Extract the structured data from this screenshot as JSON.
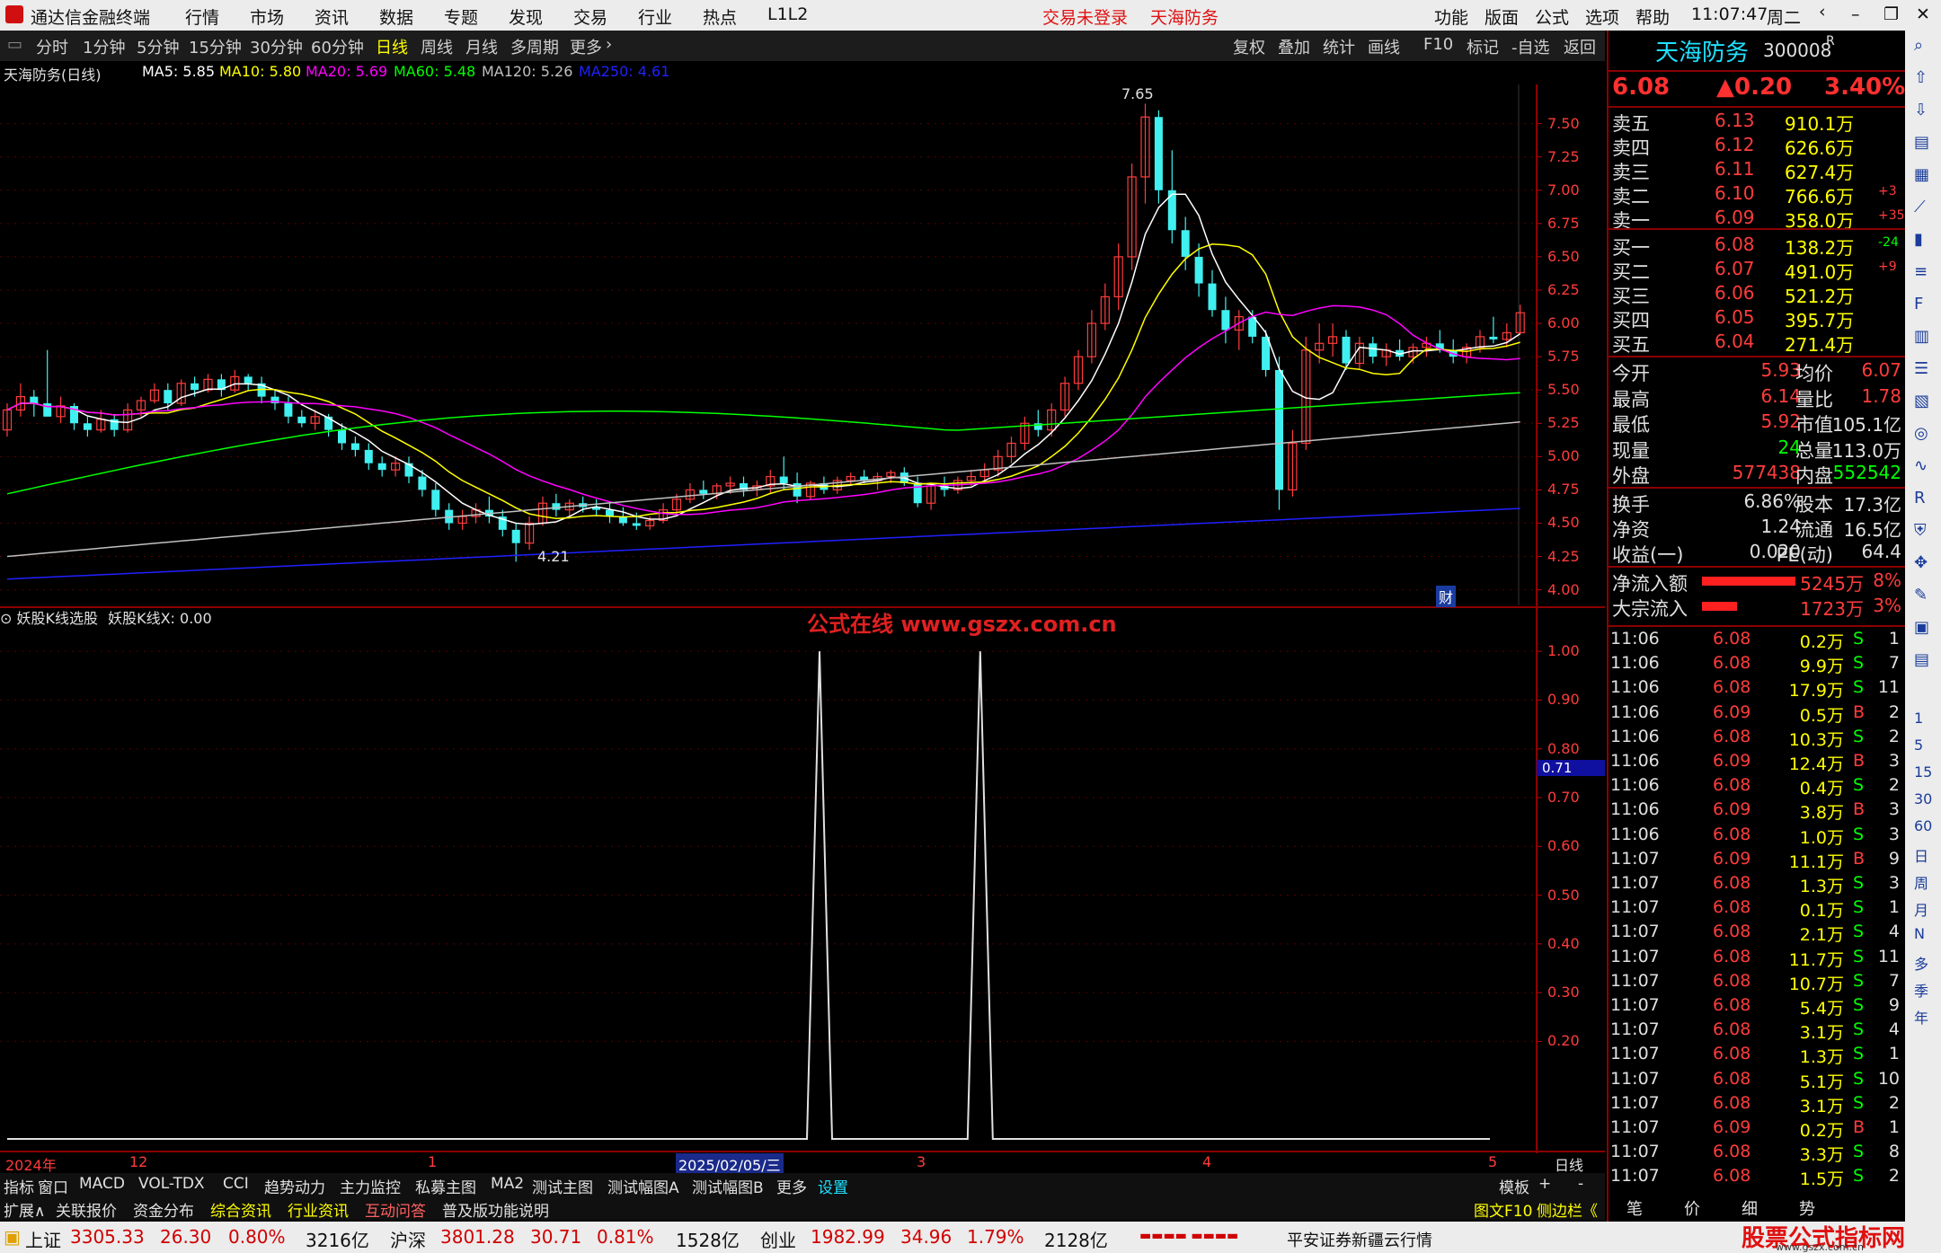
{
  "titlebar": {
    "app": "通达信金融终端",
    "menus": [
      "行情",
      "市场",
      "资讯",
      "数据",
      "专题",
      "发现",
      "交易",
      "行业",
      "热点",
      "L1L2"
    ],
    "login": "交易未登录",
    "stock": "天海防务",
    "right_menus": [
      "功能",
      "版面",
      "公式",
      "选项",
      "帮助"
    ],
    "time": "11:07:47",
    "weekday": "周二"
  },
  "toolbar": {
    "periods": [
      "分时",
      "1分钟",
      "5分钟",
      "15分钟",
      "30分钟",
      "60分钟",
      "日线",
      "周线",
      "月线",
      "多周期",
      "更多"
    ],
    "active": "日线",
    "tools": [
      "复权",
      "叠加",
      "统计",
      "画线",
      "F10",
      "标记",
      "-自选",
      "返回"
    ]
  },
  "ma_line": {
    "name": "天海防务(日线)",
    "items": [
      {
        "label": "MA5: 5.85",
        "color": "#ffffff"
      },
      {
        "label": "MA10: 5.80",
        "color": "#ffff00"
      },
      {
        "label": "MA20: 5.69",
        "color": "#ff00ff"
      },
      {
        "label": "MA60: 5.48",
        "color": "#00ff00"
      },
      {
        "label": "MA120: 5.26",
        "color": "#c0c0c0"
      },
      {
        "label": "MA250: 4.61",
        "color": "#0000ff"
      }
    ]
  },
  "price_axis": [
    "7.50",
    "7.25",
    "7.00",
    "6.75",
    "6.50",
    "6.25",
    "6.00",
    "5.75",
    "5.50",
    "5.25",
    "5.00",
    "4.75",
    "4.50",
    "4.25",
    "4.00"
  ],
  "high_label": "7.65",
  "low_label": "4.21",
  "cai_badge": "财",
  "indicator": {
    "name": "妖股K线选股",
    "value_label": "妖股K线X: 0.00",
    "axis": [
      "1.00",
      "0.90",
      "0.80",
      "0.70",
      "0.60",
      "0.50",
      "0.40",
      "0.30",
      "0.20"
    ],
    "marker": "0.71"
  },
  "watermark": "公式在线  www.gszx.com.cn",
  "dates": {
    "labels": [
      "2024年",
      "12",
      "1",
      "2025/02/05/三",
      "3",
      "4",
      "5"
    ],
    "period": "日线"
  },
  "tabs1": [
    "指标",
    "窗口",
    "MACD",
    "VOL-TDX",
    "CCI",
    "趋势动力",
    "主力监控",
    "私募主图",
    "MA2",
    "测试主图",
    "测试幅图A",
    "测试幅图B",
    "更多",
    "设置"
  ],
  "tabs1_right": [
    "模板",
    "+",
    "-"
  ],
  "tabs2": [
    "扩展∧",
    "关联报价",
    "资金分布",
    "综合资讯",
    "行业资讯",
    "互动问答",
    "普及版功能说明"
  ],
  "tabs2_right": [
    "图文F10",
    "侧边栏《"
  ],
  "quote": {
    "name": "天海防务",
    "code": "300008",
    "badge": "R",
    "price": "6.08",
    "change": "▲0.20",
    "pct": "3.40%",
    "asks": [
      {
        "label": "卖五",
        "p": "6.13",
        "v": "910.1万",
        "d": ""
      },
      {
        "label": "卖四",
        "p": "6.12",
        "v": "626.6万",
        "d": ""
      },
      {
        "label": "卖三",
        "p": "6.11",
        "v": "627.4万",
        "d": ""
      },
      {
        "label": "卖二",
        "p": "6.10",
        "v": "766.6万",
        "d": "+3"
      },
      {
        "label": "卖一",
        "p": "6.09",
        "v": "358.0万",
        "d": "+35"
      }
    ],
    "bids": [
      {
        "label": "买一",
        "p": "6.08",
        "v": "138.2万",
        "d": "-24"
      },
      {
        "label": "买二",
        "p": "6.07",
        "v": "491.0万",
        "d": "+9"
      },
      {
        "label": "买三",
        "p": "6.06",
        "v": "521.2万",
        "d": ""
      },
      {
        "label": "买四",
        "p": "6.05",
        "v": "395.7万",
        "d": ""
      },
      {
        "label": "买五",
        "p": "6.04",
        "v": "271.4万",
        "d": ""
      }
    ],
    "stats1": [
      {
        "l1": "今开",
        "v1": "5.93",
        "l2": "均价",
        "v2": "6.07"
      },
      {
        "l1": "最高",
        "v1": "6.14",
        "l2": "量比",
        "v2": "1.78"
      },
      {
        "l1": "最低",
        "v1": "5.92",
        "l2": "市值",
        "v2": "105.1亿"
      },
      {
        "l1": "现量",
        "v1": "24",
        "l2": "总量",
        "v2": "113.0万"
      },
      {
        "l1": "外盘",
        "v1": "577438",
        "l2": "内盘",
        "v2": "552542"
      }
    ],
    "stats2": [
      {
        "l1": "换手",
        "v1": "6.86%",
        "l2": "股本",
        "v2": "17.3亿"
      },
      {
        "l1": "净资",
        "v1": "1.24",
        "l2": "流通",
        "v2": "16.5亿"
      },
      {
        "l1": "收益(一)",
        "v1": "0.020",
        "l2": "PE(动)",
        "v2": "64.4"
      }
    ],
    "flows": [
      {
        "label": "净流入额",
        "val": "5245万",
        "pct": "8%",
        "fill": 0.08
      },
      {
        "label": "大宗流入",
        "val": "1723万",
        "pct": "3%",
        "fill": 0.03
      }
    ],
    "ticks": [
      [
        "11:06",
        "6.08",
        "0.2万",
        "S",
        "1"
      ],
      [
        "11:06",
        "6.08",
        "9.9万",
        "S",
        "7"
      ],
      [
        "11:06",
        "6.08",
        "17.9万",
        "S",
        "11"
      ],
      [
        "11:06",
        "6.09",
        "0.5万",
        "B",
        "2"
      ],
      [
        "11:06",
        "6.08",
        "10.3万",
        "S",
        "2"
      ],
      [
        "11:06",
        "6.09",
        "12.4万",
        "B",
        "3"
      ],
      [
        "11:06",
        "6.08",
        "0.4万",
        "S",
        "2"
      ],
      [
        "11:06",
        "6.09",
        "3.8万",
        "B",
        "3"
      ],
      [
        "11:06",
        "6.08",
        "1.0万",
        "S",
        "3"
      ],
      [
        "11:07",
        "6.09",
        "11.1万",
        "B",
        "9"
      ],
      [
        "11:07",
        "6.08",
        "1.3万",
        "S",
        "3"
      ],
      [
        "11:07",
        "6.08",
        "0.1万",
        "S",
        "1"
      ],
      [
        "11:07",
        "6.08",
        "2.1万",
        "S",
        "4"
      ],
      [
        "11:07",
        "6.08",
        "11.7万",
        "S",
        "11"
      ],
      [
        "11:07",
        "6.08",
        "10.7万",
        "S",
        "7"
      ],
      [
        "11:07",
        "6.08",
        "5.4万",
        "S",
        "9"
      ],
      [
        "11:07",
        "6.08",
        "3.1万",
        "S",
        "4"
      ],
      [
        "11:07",
        "6.08",
        "1.3万",
        "S",
        "1"
      ],
      [
        "11:07",
        "6.08",
        "5.1万",
        "S",
        "10"
      ],
      [
        "11:07",
        "6.08",
        "3.1万",
        "S",
        "2"
      ],
      [
        "11:07",
        "6.09",
        "0.2万",
        "B",
        "1"
      ],
      [
        "11:07",
        "6.08",
        "3.3万",
        "S",
        "8"
      ],
      [
        "11:07",
        "6.08",
        "1.5万",
        "S",
        "2"
      ]
    ],
    "bottom_tabs": [
      "笔",
      "价",
      "细",
      "势"
    ]
  },
  "sidebar_icons": [
    "search-icon",
    "up-icon",
    "down-icon",
    "doc-icon",
    "grid-icon",
    "chart-icon",
    "candle-icon",
    "list-icon",
    "f10-icon",
    "table-icon",
    "list2-icon",
    "fund-icon",
    "circle-icon",
    "wave-icon",
    "rsi-icon",
    "shield-icon",
    "move-icon",
    "pen-icon",
    "fs-icon",
    "fs2-icon"
  ],
  "sidebar_periods": [
    "1",
    "5",
    "15",
    "30",
    "60",
    "日",
    "周",
    "月",
    "N",
    "多",
    "季",
    "年"
  ],
  "status": {
    "items": [
      {
        "name": "上证",
        "price": "3305.33",
        "chg": "26.30",
        "pct": "0.80%",
        "amt": "3216亿"
      },
      {
        "name": "沪深",
        "price": "3801.28",
        "chg": "30.71",
        "pct": "0.81%",
        "amt": "1528亿"
      },
      {
        "name": "创业",
        "price": "1982.99",
        "chg": "34.96",
        "pct": "1.79%",
        "amt": "2128亿"
      }
    ],
    "server": "平安证券新疆云行情",
    "brand": "股票公式指标网",
    "brand_url": "www.gszx.com.cn"
  },
  "chart_data": {
    "type": "candlestick",
    "title": "天海防务(日线)",
    "ylim": [
      3.95,
      7.7
    ],
    "ylabel": "",
    "candles": [
      [
        5.2,
        5.4,
        5.15,
        5.35
      ],
      [
        5.35,
        5.55,
        5.3,
        5.45
      ],
      [
        5.45,
        5.5,
        5.3,
        5.4
      ],
      [
        5.4,
        5.8,
        5.35,
        5.3
      ],
      [
        5.3,
        5.45,
        5.25,
        5.38
      ],
      [
        5.38,
        5.4,
        5.2,
        5.25
      ],
      [
        5.25,
        5.3,
        5.15,
        5.2
      ],
      [
        5.2,
        5.35,
        5.18,
        5.28
      ],
      [
        5.28,
        5.32,
        5.15,
        5.2
      ],
      [
        5.2,
        5.4,
        5.18,
        5.35
      ],
      [
        5.35,
        5.45,
        5.3,
        5.42
      ],
      [
        5.42,
        5.55,
        5.4,
        5.5
      ],
      [
        5.5,
        5.55,
        5.35,
        5.4
      ],
      [
        5.4,
        5.58,
        5.38,
        5.55
      ],
      [
        5.55,
        5.6,
        5.45,
        5.5
      ],
      [
        5.5,
        5.62,
        5.48,
        5.58
      ],
      [
        5.58,
        5.62,
        5.45,
        5.5
      ],
      [
        5.5,
        5.65,
        5.48,
        5.6
      ],
      [
        5.6,
        5.62,
        5.5,
        5.55
      ],
      [
        5.55,
        5.6,
        5.4,
        5.45
      ],
      [
        5.45,
        5.5,
        5.35,
        5.4
      ],
      [
        5.4,
        5.45,
        5.25,
        5.3
      ],
      [
        5.3,
        5.35,
        5.22,
        5.25
      ],
      [
        5.25,
        5.35,
        5.2,
        5.3
      ],
      [
        5.3,
        5.32,
        5.15,
        5.2
      ],
      [
        5.2,
        5.25,
        5.05,
        5.1
      ],
      [
        5.1,
        5.15,
        5.0,
        5.05
      ],
      [
        5.05,
        5.1,
        4.9,
        4.95
      ],
      [
        4.95,
        5.0,
        4.85,
        4.9
      ],
      [
        4.9,
        5.0,
        4.85,
        4.95
      ],
      [
        4.95,
        5.0,
        4.8,
        4.85
      ],
      [
        4.85,
        4.9,
        4.7,
        4.75
      ],
      [
        4.75,
        4.8,
        4.55,
        4.6
      ],
      [
        4.6,
        4.65,
        4.45,
        4.5
      ],
      [
        4.5,
        4.6,
        4.45,
        4.55
      ],
      [
        4.55,
        4.65,
        4.5,
        4.6
      ],
      [
        4.6,
        4.7,
        4.5,
        4.55
      ],
      [
        4.55,
        4.6,
        4.4,
        4.45
      ],
      [
        4.45,
        4.5,
        4.21,
        4.35
      ],
      [
        4.35,
        4.55,
        4.3,
        4.5
      ],
      [
        4.5,
        4.7,
        4.48,
        4.65
      ],
      [
        4.65,
        4.72,
        4.55,
        4.6
      ],
      [
        4.6,
        4.68,
        4.55,
        4.65
      ],
      [
        4.65,
        4.7,
        4.58,
        4.62
      ],
      [
        4.62,
        4.68,
        4.55,
        4.6
      ],
      [
        4.6,
        4.65,
        4.5,
        4.55
      ],
      [
        4.55,
        4.62,
        4.48,
        4.5
      ],
      [
        4.5,
        4.58,
        4.45,
        4.48
      ],
      [
        4.48,
        4.55,
        4.45,
        4.52
      ],
      [
        4.52,
        4.65,
        4.5,
        4.6
      ],
      [
        4.6,
        4.72,
        4.55,
        4.68
      ],
      [
        4.68,
        4.8,
        4.65,
        4.75
      ],
      [
        4.75,
        4.82,
        4.68,
        4.72
      ],
      [
        4.72,
        4.8,
        4.68,
        4.78
      ],
      [
        4.78,
        4.85,
        4.72,
        4.8
      ],
      [
        4.8,
        4.85,
        4.7,
        4.75
      ],
      [
        4.75,
        4.82,
        4.7,
        4.78
      ],
      [
        4.78,
        4.9,
        4.72,
        4.85
      ],
      [
        4.85,
        5.0,
        4.75,
        4.8
      ],
      [
        4.8,
        4.88,
        4.65,
        4.7
      ],
      [
        4.7,
        4.82,
        4.68,
        4.8
      ],
      [
        4.8,
        4.85,
        4.72,
        4.75
      ],
      [
        4.75,
        4.85,
        4.72,
        4.82
      ],
      [
        4.82,
        4.88,
        4.78,
        4.85
      ],
      [
        4.85,
        4.9,
        4.8,
        4.82
      ],
      [
        4.82,
        4.88,
        4.75,
        4.85
      ],
      [
        4.85,
        4.9,
        4.8,
        4.88
      ],
      [
        4.88,
        4.92,
        4.78,
        4.8
      ],
      [
        4.8,
        4.85,
        4.62,
        4.65
      ],
      [
        4.65,
        4.8,
        4.6,
        4.78
      ],
      [
        4.78,
        4.85,
        4.7,
        4.75
      ],
      [
        4.75,
        4.85,
        4.72,
        4.82
      ],
      [
        4.82,
        4.9,
        4.78,
        4.85
      ],
      [
        4.85,
        4.95,
        4.8,
        4.9
      ],
      [
        4.9,
        5.05,
        4.85,
        5.0
      ],
      [
        5.0,
        5.15,
        4.95,
        5.1
      ],
      [
        5.1,
        5.3,
        5.05,
        5.25
      ],
      [
        5.25,
        5.35,
        5.15,
        5.2
      ],
      [
        5.2,
        5.4,
        5.15,
        5.35
      ],
      [
        5.35,
        5.6,
        5.3,
        5.55
      ],
      [
        5.55,
        5.8,
        5.5,
        5.75
      ],
      [
        5.75,
        6.1,
        5.7,
        6.0
      ],
      [
        6.0,
        6.3,
        5.95,
        6.2
      ],
      [
        6.2,
        6.6,
        6.1,
        6.5
      ],
      [
        6.5,
        7.2,
        6.4,
        7.1
      ],
      [
        7.1,
        7.65,
        6.9,
        7.55
      ],
      [
        7.55,
        7.6,
        6.9,
        7.0
      ],
      [
        7.0,
        7.3,
        6.6,
        6.7
      ],
      [
        6.7,
        6.8,
        6.4,
        6.5
      ],
      [
        6.5,
        6.6,
        6.2,
        6.3
      ],
      [
        6.3,
        6.4,
        6.05,
        6.1
      ],
      [
        6.1,
        6.2,
        5.85,
        5.95
      ],
      [
        5.95,
        6.1,
        5.8,
        6.05
      ],
      [
        6.05,
        6.1,
        5.85,
        5.9
      ],
      [
        5.9,
        5.95,
        5.6,
        5.65
      ],
      [
        5.65,
        5.75,
        4.6,
        4.75
      ],
      [
        4.75,
        5.2,
        4.7,
        5.1
      ],
      [
        5.1,
        5.9,
        5.05,
        5.8
      ],
      [
        5.8,
        6.0,
        5.7,
        5.85
      ],
      [
        5.85,
        6.0,
        5.75,
        5.9
      ],
      [
        5.9,
        5.95,
        5.65,
        5.7
      ],
      [
        5.7,
        5.9,
        5.65,
        5.85
      ],
      [
        5.85,
        5.9,
        5.7,
        5.75
      ],
      [
        5.75,
        5.85,
        5.68,
        5.8
      ],
      [
        5.8,
        5.88,
        5.72,
        5.75
      ],
      [
        5.75,
        5.85,
        5.7,
        5.82
      ],
      [
        5.82,
        5.9,
        5.75,
        5.85
      ],
      [
        5.85,
        5.95,
        5.78,
        5.8
      ],
      [
        5.8,
        5.88,
        5.7,
        5.75
      ],
      [
        5.75,
        5.85,
        5.7,
        5.82
      ],
      [
        5.82,
        5.95,
        5.78,
        5.9
      ],
      [
        5.9,
        6.05,
        5.85,
        5.88
      ],
      [
        5.88,
        6.0,
        5.82,
        5.93
      ],
      [
        5.93,
        6.14,
        5.92,
        6.08
      ]
    ],
    "ma_values": {
      "MA5": 5.85,
      "MA10": 5.8,
      "MA20": 5.69,
      "MA60": 5.48,
      "MA120": 5.26,
      "MA250": 4.61
    },
    "indicator_series": {
      "name": "妖股K线X",
      "ylim": [
        0,
        1.05
      ],
      "spikes_at_candle": [
        60,
        72
      ],
      "value": 1.0
    }
  }
}
